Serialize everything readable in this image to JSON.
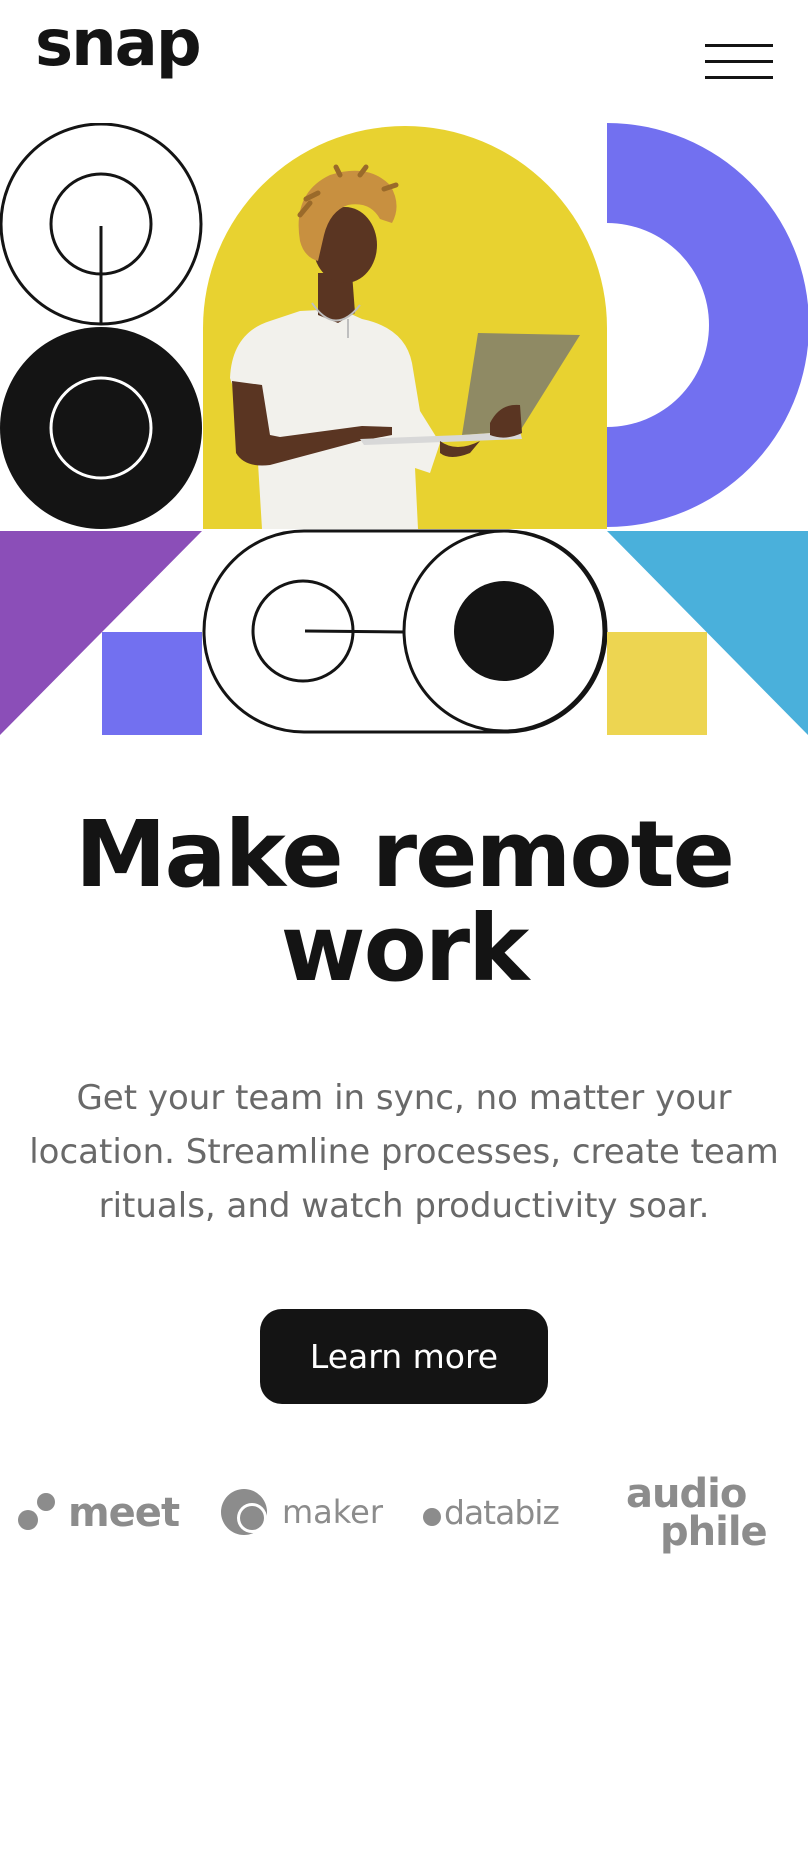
{
  "header": {
    "logo_text": "snap",
    "menu_icon": "hamburger-menu-icon"
  },
  "hero": {
    "image_alt": "person holding laptop in front of yellow shape",
    "colors": {
      "yellow": "#E8D230",
      "purple": "#7270F0",
      "violet": "#8B4EB8",
      "blue": "#4AB0DB",
      "pale_yellow": "#EDD551",
      "black": "#141414"
    }
  },
  "main": {
    "headline_lines": [
      "Make remote",
      "work"
    ],
    "subtext_lines": [
      "Get your team in sync, no matter your",
      "location. Streamline processes, create team",
      "rituals, and watch productivity soar."
    ],
    "cta_label": "Learn more"
  },
  "clients": {
    "logos": [
      {
        "name": "meet",
        "text": "meet"
      },
      {
        "name": "maker",
        "text": "maker"
      },
      {
        "name": "databiz",
        "text": "databiz"
      },
      {
        "name": "audiophile",
        "text_top": "audio",
        "text_bottom": "phile"
      }
    ]
  }
}
